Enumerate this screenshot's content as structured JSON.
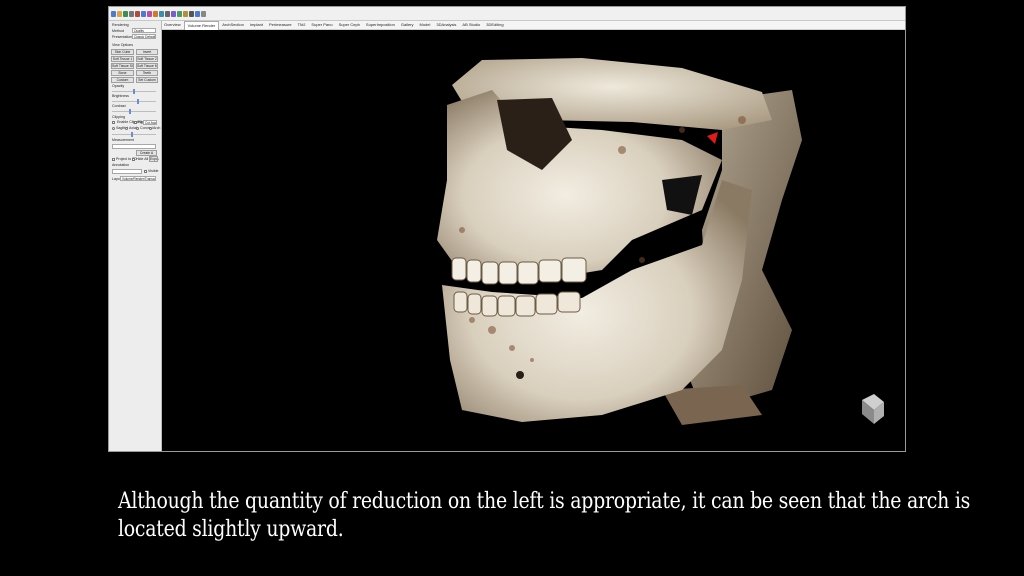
{
  "toolbar": {
    "icons": [
      "file-icon",
      "open-icon",
      "save-icon",
      "print-icon",
      "undo-icon",
      "redo-icon",
      "color-icon",
      "measure-icon",
      "angle-icon",
      "arrow-icon",
      "zoom-icon",
      "pan-icon",
      "rotate-icon",
      "camera-icon",
      "settings-icon",
      "help-icon"
    ]
  },
  "tabs": [
    {
      "label": "Overview"
    },
    {
      "label": "Volume Render",
      "active": true
    },
    {
      "label": "ArchSection"
    },
    {
      "label": "Implant"
    },
    {
      "label": "Perimeasure"
    },
    {
      "label": "TMJ"
    },
    {
      "label": "Super Pano"
    },
    {
      "label": "Super Ceph"
    },
    {
      "label": "SuperImposition"
    },
    {
      "label": "Gallery"
    },
    {
      "label": "Model"
    },
    {
      "label": "3DAnalysis"
    },
    {
      "label": "AB Studio"
    },
    {
      "label": "3DEditing"
    }
  ],
  "panel": {
    "rendering_label": "Rendering",
    "method_label": "Method",
    "method_value": "Quality",
    "presentation_label": "Presentation",
    "presentation_value": "Classic Default",
    "view_options_label": "View Options",
    "buttons": [
      "Skin Cube",
      "Invert",
      "Soft Tissue 1",
      "Soft Tissue 2",
      "Soft Tissue Shade",
      "Soft Tissue Mirror",
      "Bone",
      "Teeth",
      "Custom",
      "Set Custom"
    ],
    "opacity_label": "Opacity",
    "brightness_label": "Brightness",
    "contrast_label": "Contrast",
    "clipping_label": "Clipping",
    "enable_label": "Enable Clipping",
    "flip_label": "Flip",
    "clip_value": "Cut Away",
    "sagittal_label": "Sagittal",
    "axial_label": "Axial",
    "coronal_label": "Coronal",
    "arch_label": "Arch",
    "measurement_label": "Measurement",
    "create_label": "Create A",
    "project_label": "Project to 2D",
    "hide_label": "Hide All Views",
    "export_label": "Export",
    "annotation_label": "Annotation",
    "visible_label": "Visible",
    "layout_label": "Layout",
    "layout_value": "Volume/Render/Transparent"
  },
  "caption": {
    "line1": "Although the quantity of reduction on the left is appropriate, it can be seen that the arch is",
    "line2": "located slightly upward."
  }
}
